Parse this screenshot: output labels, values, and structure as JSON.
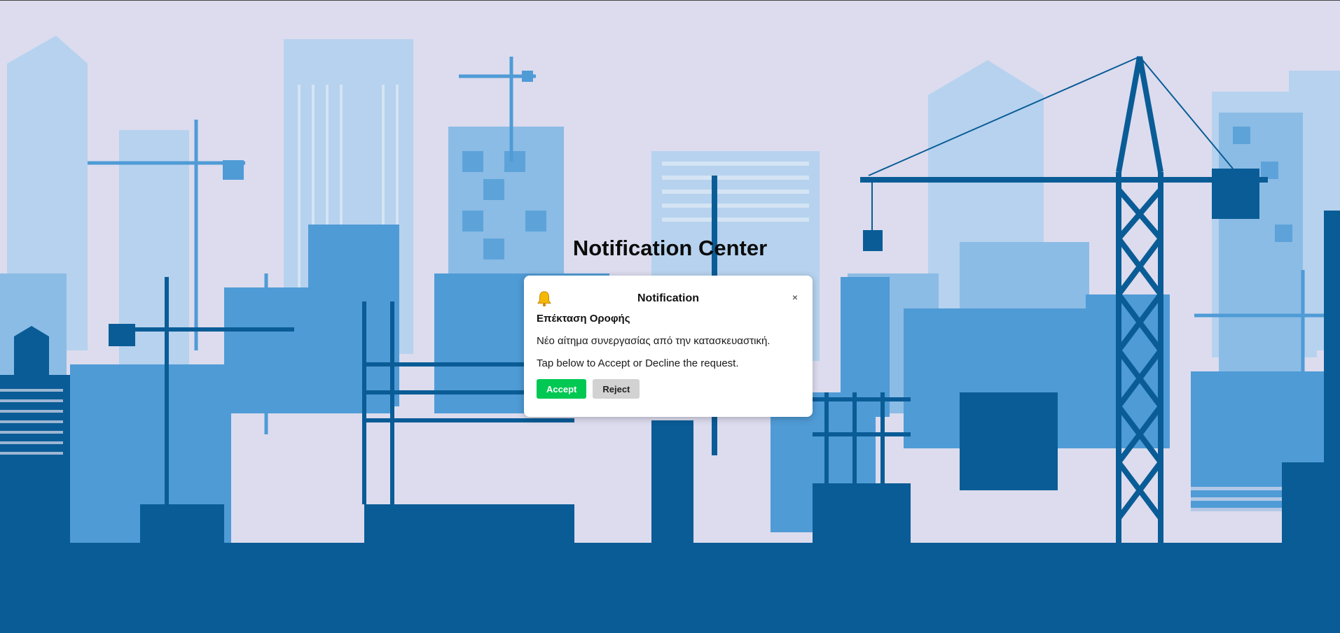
{
  "page": {
    "title": "Notification Center"
  },
  "dialog": {
    "icon": "bell-icon",
    "title": "Notification",
    "close_label": "×",
    "subject": "Επέκταση Οροφής",
    "message": "Νέο αίτημα συνεργασίας από την κατασκευαστική.",
    "instruction": "Tap below to Accept or Decline the request.",
    "accept_label": "Accept",
    "reject_label": "Reject"
  },
  "colors": {
    "background": "#dcdcee",
    "skyline_light": "#a9cbe9",
    "skyline_mid": "#5da3d9",
    "skyline_dark": "#0a5c96",
    "accept_button": "#00c853",
    "reject_button": "#d2d2d2"
  }
}
